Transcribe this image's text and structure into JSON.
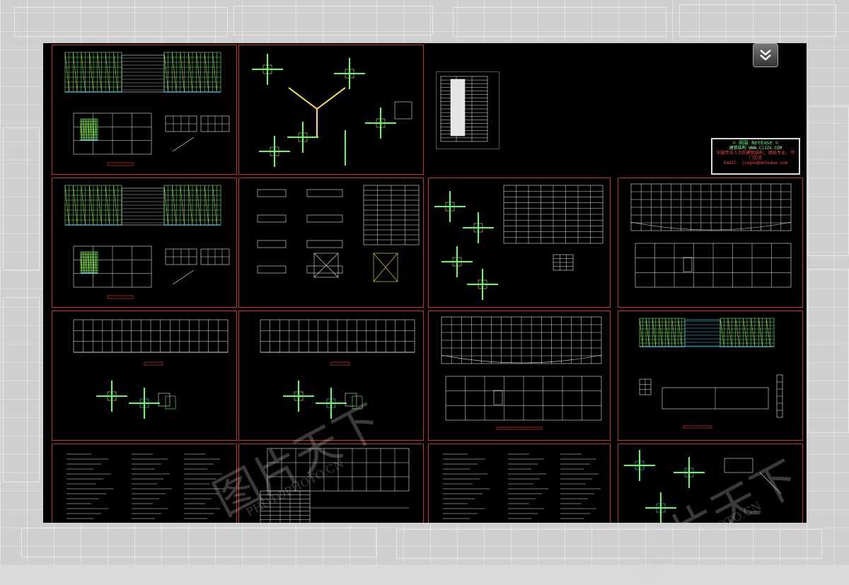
{
  "toolbar": {
    "collapse_icon": "double-chevron-down-icon"
  },
  "title_block": {
    "title": "= 网易 NetEase =",
    "line1": "建筑结构  WWW.CJJZX.COM",
    "line2": "中国专业人士的建筑结构, 图纸专业, 开门交流",
    "line3": "Email: jiegou@netease.com"
  },
  "watermark": {
    "brand": "图片天下",
    "domain": "PHOTOPHOTO.CN"
  },
  "colors": {
    "background": "#000000",
    "panel_border": "#c0392b",
    "cad_green": "#5cff5c",
    "cad_yellow": "#ffe14a",
    "cad_cyan": "#3ad9ff",
    "cad_white": "#e6e6e6"
  }
}
